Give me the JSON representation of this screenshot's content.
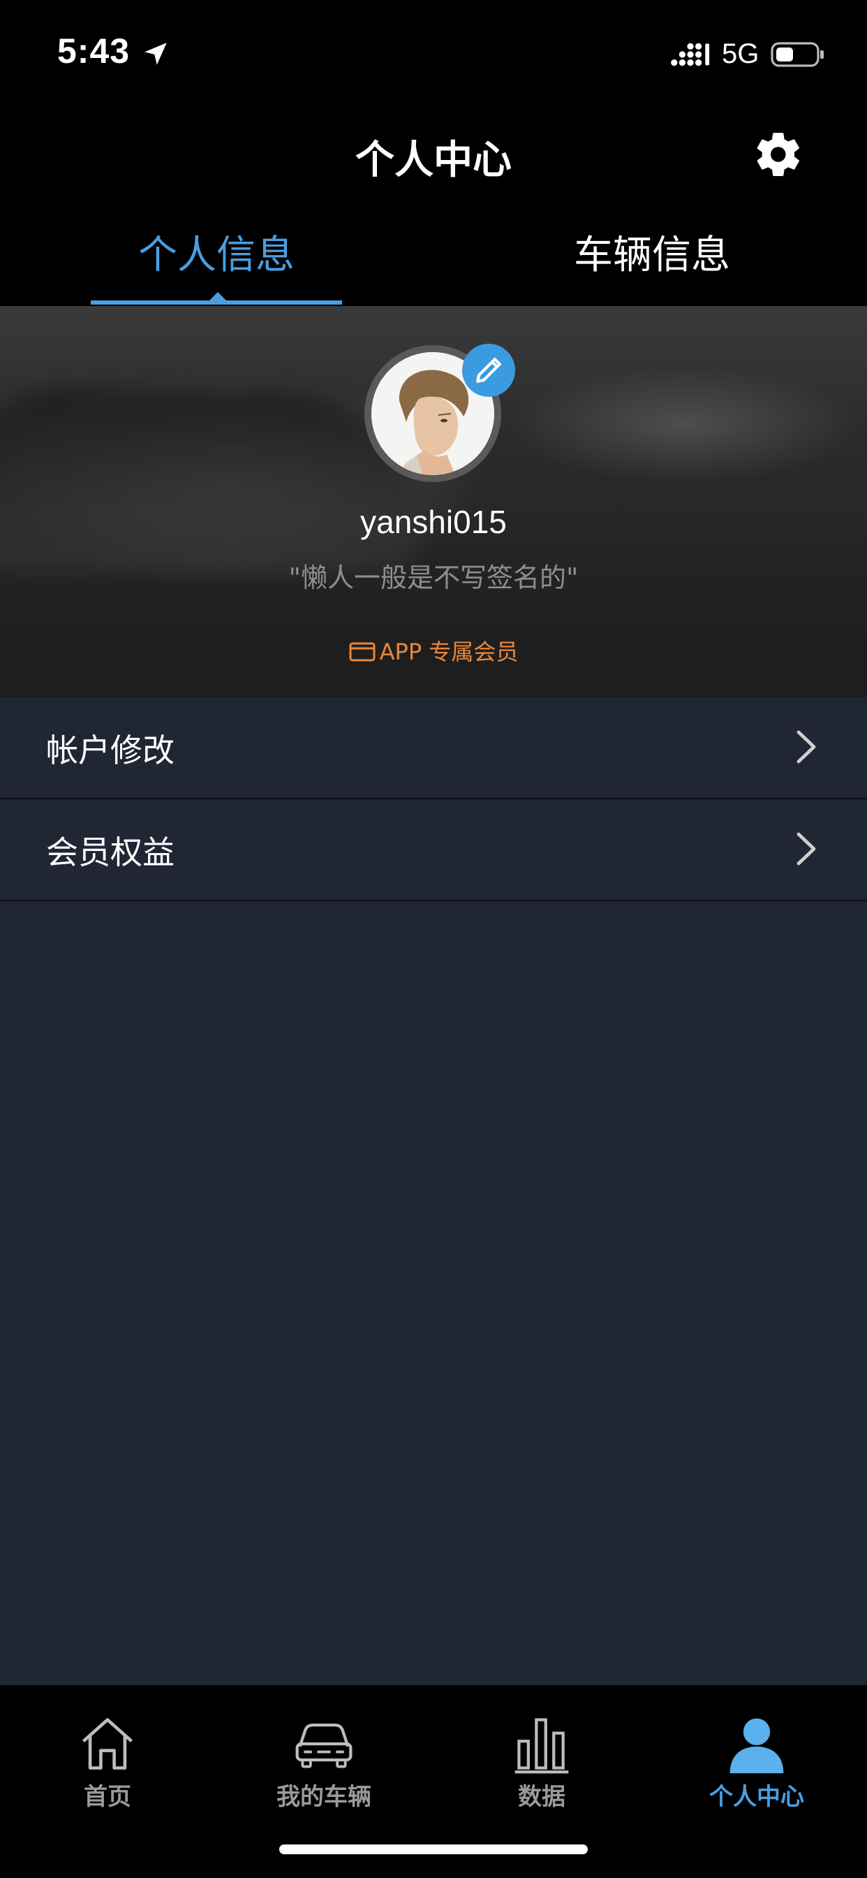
{
  "status_bar": {
    "time": "5:43",
    "network": "5G"
  },
  "header": {
    "title": "个人中心"
  },
  "tabs": [
    {
      "label": "个人信息",
      "active": true
    },
    {
      "label": "车辆信息",
      "active": false
    }
  ],
  "profile": {
    "username": "yanshi015",
    "signature": "\"懒人一般是不写签名的\"",
    "member_badge": "APP 专属会员"
  },
  "menu": [
    {
      "label": "帐户修改"
    },
    {
      "label": "会员权益"
    }
  ],
  "tab_bar": [
    {
      "label": "首页",
      "icon": "home-icon",
      "active": false
    },
    {
      "label": "我的车辆",
      "icon": "car-icon",
      "active": false
    },
    {
      "label": "数据",
      "icon": "bar-chart-icon",
      "active": false
    },
    {
      "label": "个人中心",
      "icon": "person-icon",
      "active": true
    }
  ],
  "colors": {
    "accent": "#4a9ee0",
    "badge": "#e9873a",
    "background": "#202634"
  }
}
